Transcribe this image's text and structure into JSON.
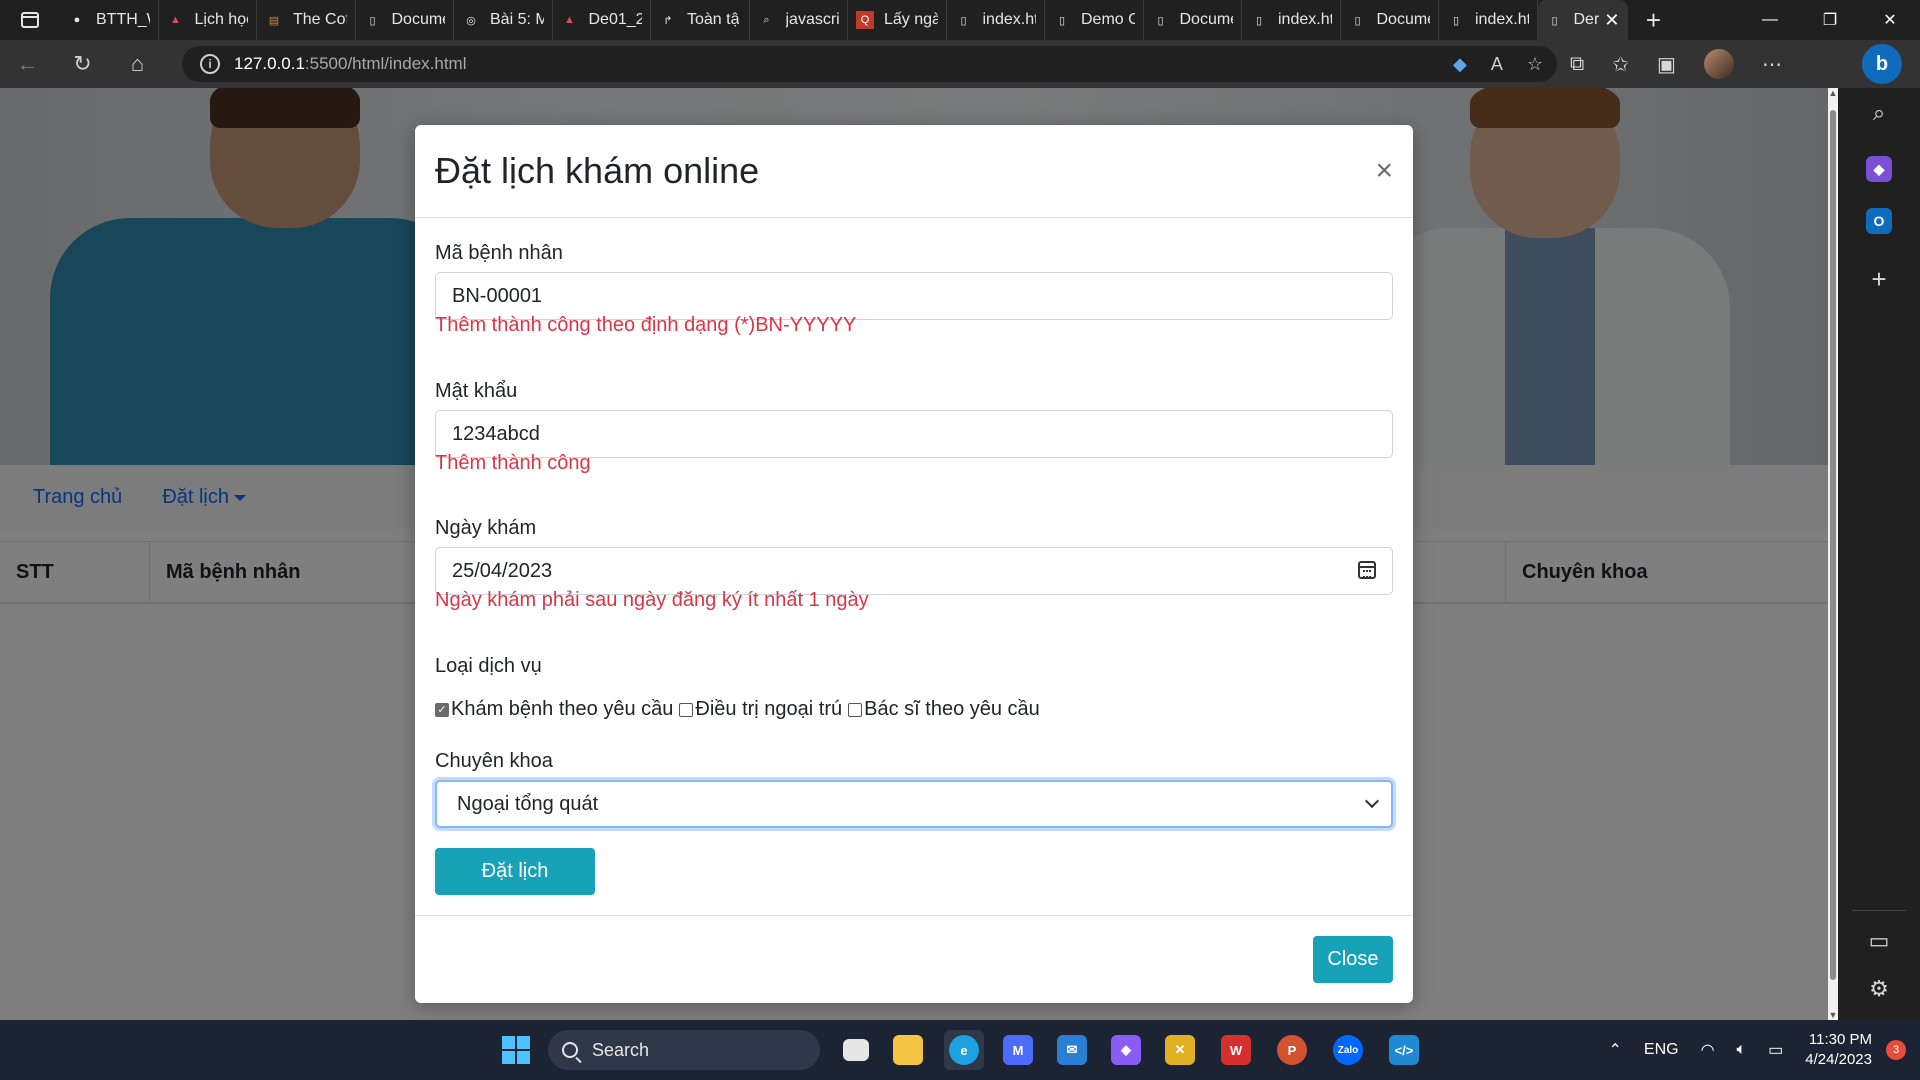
{
  "browser": {
    "tabs": [
      {
        "title": "BTTH_W",
        "icon": "github-icon"
      },
      {
        "title": "Lịch học",
        "icon": "pdf-icon"
      },
      {
        "title": "The Cof",
        "icon": "book-icon"
      },
      {
        "title": "Docume",
        "icon": "page-icon"
      },
      {
        "title": "Bài 5: M",
        "icon": "at-icon"
      },
      {
        "title": "De01_2(",
        "icon": "pdf-icon"
      },
      {
        "title": "Toàn tậ",
        "icon": "arrow-icon"
      },
      {
        "title": "javascri",
        "icon": "search-icon"
      },
      {
        "title": "Lấy ngà",
        "icon": "qa-icon"
      },
      {
        "title": "index.ht",
        "icon": "page-icon"
      },
      {
        "title": "Demo C",
        "icon": "page-icon"
      },
      {
        "title": "Docume",
        "icon": "page-icon"
      },
      {
        "title": "index.ht",
        "icon": "page-icon"
      },
      {
        "title": "Docume",
        "icon": "page-icon"
      },
      {
        "title": "index.ht",
        "icon": "page-icon"
      }
    ],
    "active_tab": {
      "title": "Der",
      "close": "✕"
    },
    "new_tab": "+",
    "url_host": "127.0.0.1",
    "url_path": ":5500/html/index.html"
  },
  "page": {
    "nav": {
      "home": "Trang chủ",
      "booking": "Đặt lịch"
    },
    "table_headers": [
      "STT",
      "Mã bệnh nhân",
      "Chuyên khoa"
    ]
  },
  "modal": {
    "title": "Đặt lịch khám online",
    "close_symbol": "×",
    "patient_id": {
      "label": "Mã bệnh nhân",
      "value": "BN-00001",
      "message": "Thêm thành công theo định dạng (*)BN-YYYYY"
    },
    "password": {
      "label": "Mật khẩu",
      "value": "1234abcd",
      "message": "Thêm thành công"
    },
    "date": {
      "label": "Ngày khám",
      "value": "25/04/2023",
      "message": "Ngày khám phải sau ngày đăng ký ít nhất 1 ngày"
    },
    "services": {
      "label": "Loại dịch vụ",
      "options": [
        {
          "label": "Khám bệnh theo yêu cầu",
          "checked": true
        },
        {
          "label": "Điều trị ngoại trú",
          "checked": false
        },
        {
          "label": "Bác sĩ theo yêu cầu",
          "checked": false
        }
      ]
    },
    "specialty": {
      "label": "Chuyên khoa",
      "selected": "Ngoại tổng quát"
    },
    "submit_label": "Đặt lịch",
    "close_label": "Close"
  },
  "taskbar": {
    "search_label": "Search",
    "lang": "ENG",
    "time": "11:30 PM",
    "date": "4/24/2023",
    "notification_count": "3"
  },
  "colors": {
    "accent_button": "#17a2b8",
    "error_text": "#dc3545",
    "link": "#0d6efd"
  }
}
